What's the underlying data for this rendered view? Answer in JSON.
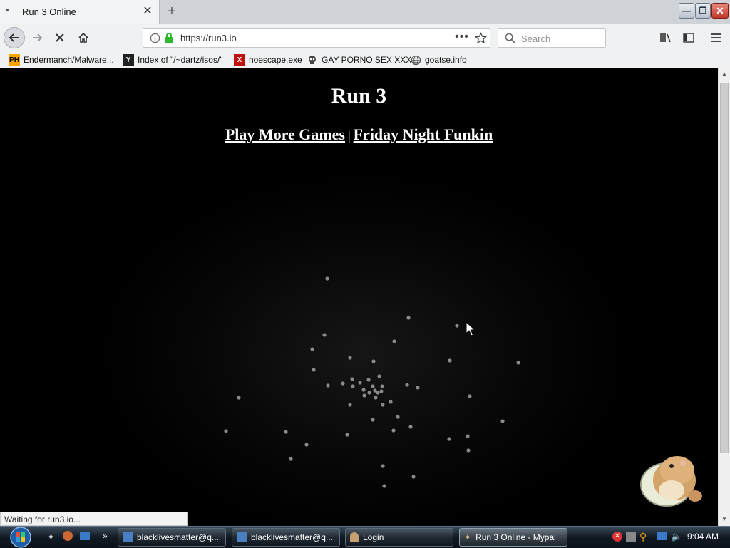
{
  "browser": {
    "tab": {
      "title": "Run 3 Online"
    },
    "url": "https://run3.io",
    "search_placeholder": "Search",
    "bookmarks": [
      {
        "icon": "ph",
        "label": "Endermanch/Malware..."
      },
      {
        "icon": "yc",
        "label": "Index of \"/~dartz/isos/\""
      },
      {
        "icon": "x",
        "label": "noescape.exe"
      },
      {
        "icon": "skull",
        "label": "GAY PORNO SEX XXX"
      },
      {
        "icon": "globe",
        "label": "goatse.info"
      }
    ],
    "icon_labels": {
      "ph": "PH",
      "yc": "Y",
      "x": "X"
    },
    "status": "Waiting for run3.io..."
  },
  "page": {
    "title": "Run 3",
    "links": [
      "Play More Games",
      "Friday Night Funkin"
    ],
    "separator": "|"
  },
  "taskbar": {
    "items": [
      {
        "label": "blacklivesmatter@q..."
      },
      {
        "label": "blacklivesmatter@q..."
      },
      {
        "label": "Login"
      },
      {
        "label": "Run 3 Online - Mypal"
      }
    ],
    "time": "9:04 AM"
  },
  "colors": {
    "accent_green": "#2eb82e",
    "taskbar": "#101a24",
    "page_bg": "#000000"
  }
}
